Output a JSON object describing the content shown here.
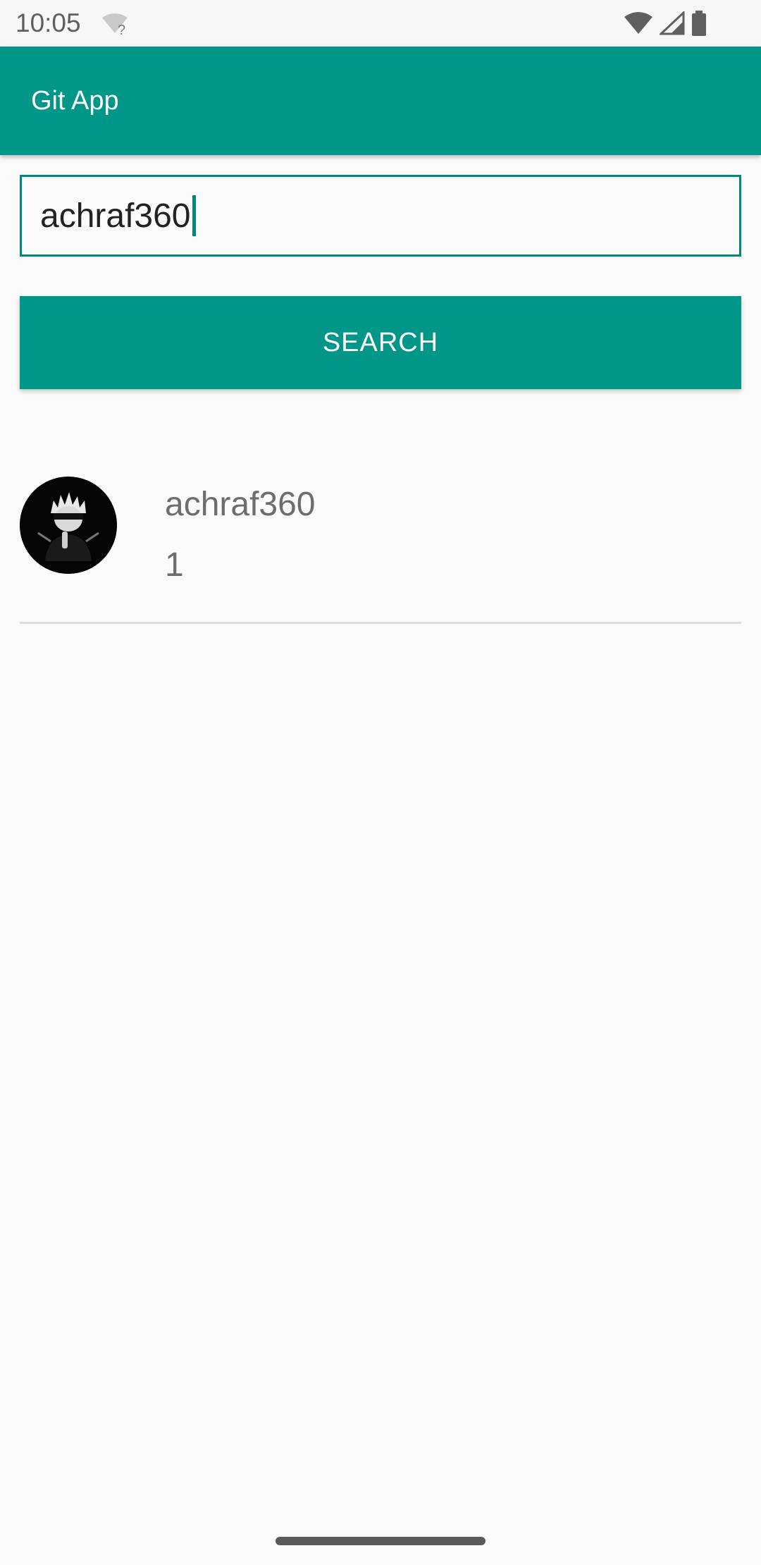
{
  "status_bar": {
    "time": "10:05",
    "icons": [
      "wifi-question-icon",
      "wifi-icon",
      "cell-signal-icon",
      "battery-icon"
    ]
  },
  "app_bar": {
    "title": "Git App",
    "color": "#009688"
  },
  "search": {
    "value": "achraf360",
    "button_label": "SEARCH"
  },
  "results": [
    {
      "username": "achraf360",
      "count": "1"
    }
  ],
  "colors": {
    "accent": "#009688",
    "background": "#fafafa",
    "text_secondary": "#6d6d6d"
  }
}
